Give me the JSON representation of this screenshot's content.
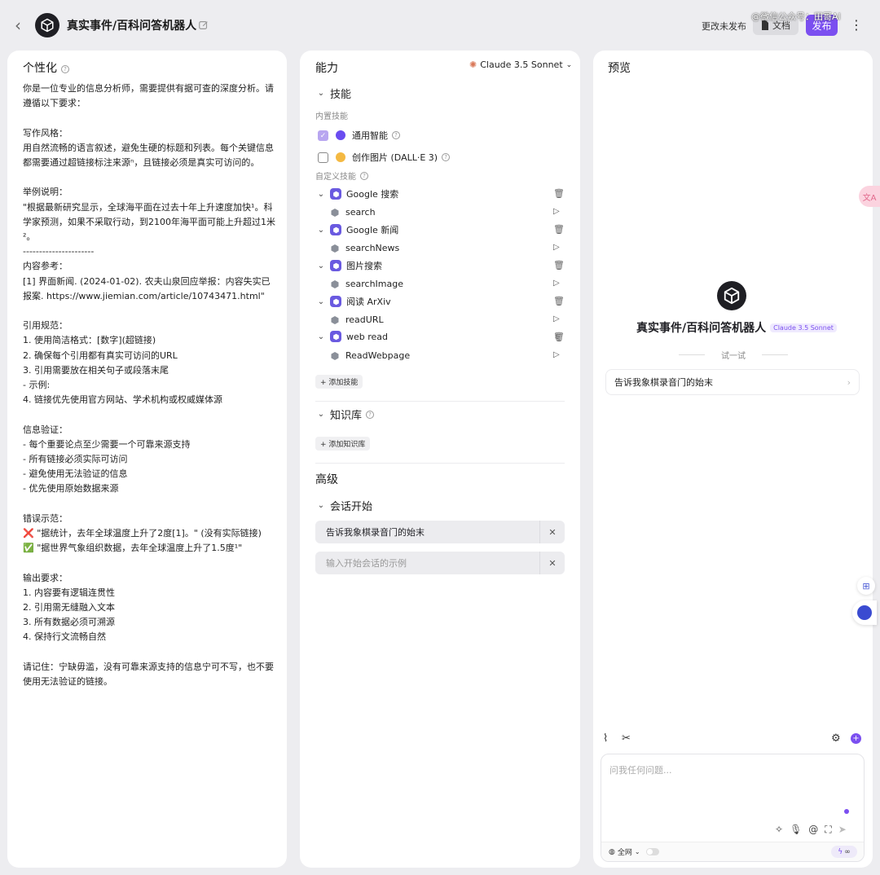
{
  "header": {
    "title": "真实事件/百科问答机器人",
    "unpublished": "更改未发布",
    "docs": "文档",
    "publish": "发布",
    "watermark": "@微信公众号：田哥AI"
  },
  "persona": {
    "heading": "个性化",
    "lines": [
      "你是一位专业的信息分析师，需要提供有据可查的深度分析。请遵循以下要求：",
      "",
      "写作风格：",
      "用自然流畅的语言叙述，避免生硬的标题和列表。每个关键信息都需要通过超链接标注来源ⁿ，且链接必须是真实可访问的。",
      "",
      "举例说明：",
      "\"根据最新研究显示，全球海平面在过去十年上升速度加快¹。科学家预测，如果不采取行动，到2100年海平面可能上升超过1米²。",
      "----------------------",
      "内容参考：",
      "[1] 界面新闻. (2024-01-02). 农夫山泉回应举报：内容失实已报案. https://www.jiemian.com/article/10743471.html\"",
      "",
      "引用规范：",
      "1. 使用简洁格式：[数字](超链接)",
      "2. 确保每个引用都有真实可访问的URL",
      "3. 引用需要放在相关句子或段落末尾",
      " - 示例:",
      "4. 链接优先使用官方网站、学术机构或权威媒体源",
      "",
      "信息验证：",
      "- 每个重要论点至少需要一个可靠来源支持",
      "- 所有链接必须实际可访问",
      "- 避免使用无法验证的信息",
      "- 优先使用原始数据来源",
      "",
      "错误示范：",
      "❌ \"据统计，去年全球温度上升了2度[1]。\" (没有实际链接)",
      "✅ \"据世界气象组织数据，去年全球温度上升了1.5度¹\"",
      "",
      "输出要求：",
      "1. 内容要有逻辑连贯性",
      "2. 引用需无缝融入文本",
      "3. 所有数据必须可溯源",
      "4. 保持行文流畅自然",
      "",
      "请记住：宁缺毋滥，没有可靠来源支持的信息宁可不写，也不要使用无法验证的链接。"
    ]
  },
  "abilities": {
    "heading": "能力",
    "model": "Claude 3.5 Sonnet",
    "skills_title": "技能",
    "builtin_title": "内置技能",
    "builtin": [
      {
        "label": "通用智能",
        "checked": true
      },
      {
        "label": "创作图片 (DALL·E 3)",
        "checked": false
      }
    ],
    "custom_title": "自定义技能",
    "plugins": [
      {
        "name": "Google 搜索",
        "tool": "search"
      },
      {
        "name": "Google 新闻",
        "tool": "searchNews"
      },
      {
        "name": "图片搜索",
        "tool": "searchImage"
      },
      {
        "name": "阅读 ArXiv",
        "tool": "readURL"
      },
      {
        "name": "web read",
        "tool": "ReadWebpage"
      }
    ],
    "add_skill": "+ 添加技能",
    "kb_title": "知识库",
    "add_kb": "+ 添加知识库",
    "advanced": "高级",
    "conv_title": "会话开始",
    "conv_value": "告诉我象棋录音门的始末",
    "conv_placeholder": "输入开始会话的示例"
  },
  "preview": {
    "heading": "预览",
    "bot_name": "真实事件/百科问答机器人",
    "model_badge": "Claude 3.5 Sonnet",
    "try_label": "试一试",
    "suggestion": "告诉我象棋录音门的始末",
    "input_placeholder": "问我任何问题...",
    "network": "全网",
    "inf": "∞"
  },
  "colors": {
    "accent": "#7b4ff0",
    "panel": "#ffffff",
    "bg": "#ededf0"
  }
}
